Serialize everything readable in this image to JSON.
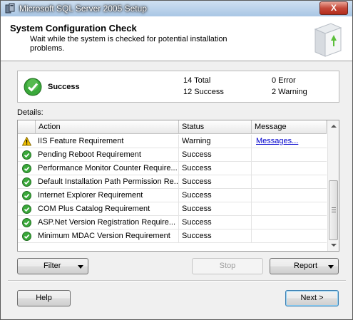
{
  "window": {
    "title": "Microsoft SQL Server 2005 Setup",
    "close_label": "X"
  },
  "header": {
    "title": "System Configuration Check",
    "subtitle": "Wait while the system is checked for potential installation problems."
  },
  "summary": {
    "status": "Success",
    "total": "14 Total",
    "success": "12 Success",
    "error": "0 Error",
    "warning": "2 Warning"
  },
  "details_label": "Details:",
  "grid": {
    "columns": [
      "Action",
      "Status",
      "Message"
    ],
    "rows": [
      {
        "icon": "warning-icon",
        "action": "IIS Feature Requirement",
        "status": "Warning",
        "message": "Messages..."
      },
      {
        "icon": "success-icon",
        "action": "Pending Reboot Requirement",
        "status": "Success",
        "message": ""
      },
      {
        "icon": "success-icon",
        "action": "Performance Monitor Counter Require...",
        "status": "Success",
        "message": ""
      },
      {
        "icon": "success-icon",
        "action": "Default Installation Path Permission Re...",
        "status": "Success",
        "message": ""
      },
      {
        "icon": "success-icon",
        "action": "Internet Explorer Requirement",
        "status": "Success",
        "message": ""
      },
      {
        "icon": "success-icon",
        "action": "COM Plus Catalog Requirement",
        "status": "Success",
        "message": ""
      },
      {
        "icon": "success-icon",
        "action": "ASP.Net Version Registration Require...",
        "status": "Success",
        "message": ""
      },
      {
        "icon": "success-icon",
        "action": "Minimum MDAC Version Requirement",
        "status": "Success",
        "message": ""
      }
    ]
  },
  "buttons": {
    "filter": "Filter",
    "stop": "Stop",
    "report": "Report",
    "help": "Help",
    "next": "Next >"
  },
  "colors": {
    "success": "#3aa83a",
    "warning": "#f2c200",
    "link": "#0000cc"
  }
}
